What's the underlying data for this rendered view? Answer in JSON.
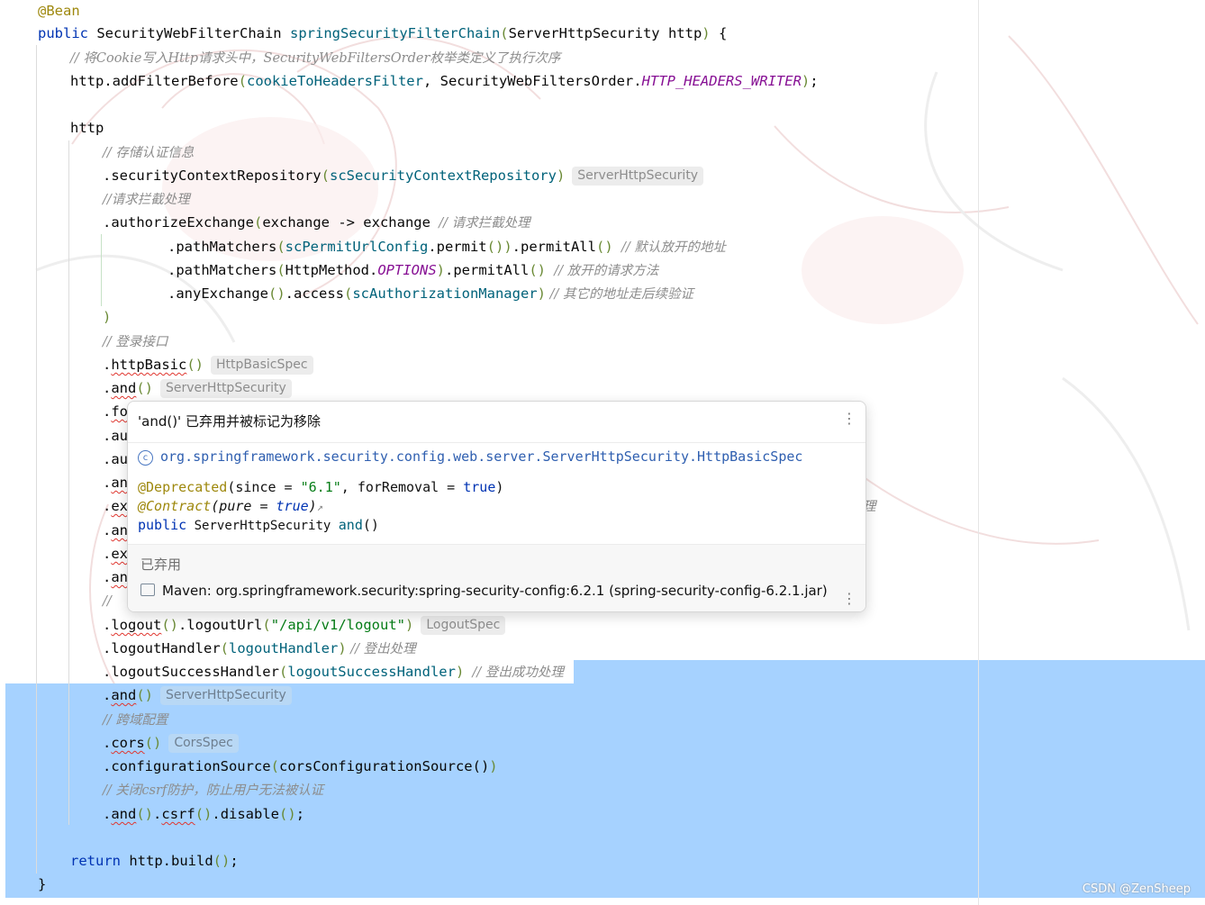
{
  "editor": {
    "lines": {
      "l1": {
        "ann": "@Bean"
      },
      "l2": {
        "kw": "public",
        "type": "SecurityWebFilterChain",
        "method": "springSecurityFilterChain",
        "open": "(",
        "param": "ServerHttpSecurity http",
        "close": ")",
        "brace": " {"
      },
      "l3": {
        "comment": "// 将Cookie写入Http请求头中，SecurityWebFiltersOrder枚举类定义了执行次序"
      },
      "l4": {
        "pre": "http.addFilterBefore",
        "open": "(",
        "arg1": "cookieToHeadersFilter",
        "mid": ", SecurityWebFiltersOrder.",
        "const": "HTTP_HEADERS_WRITER",
        "close": ")",
        "end": ";"
      },
      "l5": {
        "text": "http"
      },
      "l6": {
        "comment": "// 存储认证信息"
      },
      "l7": {
        "pre": ".securityContextRepository",
        "open": "(",
        "arg": "scSecurityContextRepository",
        "close": ")",
        "hint": "ServerHttpSecurity"
      },
      "l8": {
        "comment": "//请求拦截处理"
      },
      "l9": {
        "pre": ".authorizeExchange",
        "open": "(",
        "body": "exchange -> exchange ",
        "comment": "// 请求拦截处理"
      },
      "l10": {
        "pre": ".pathMatchers",
        "open": "(",
        "field": "scPermitUrlConfig",
        "mid": ".permit",
        "paren": "()",
        "close": ")",
        "tail": ".permitAll",
        "paren2": "() ",
        "comment": "// 默认放开的地址"
      },
      "l11": {
        "pre": ".pathMatchers",
        "open": "(",
        "mid": "HttpMethod.",
        "const": "OPTIONS",
        "close": ")",
        "tail": ".permitAll",
        "paren": "() ",
        "comment": "// 放开的请求方法"
      },
      "l12": {
        "pre": ".anyExchange",
        "paren": "()",
        "mid": ".access",
        "open": "(",
        "arg": "scAuthorizationManager",
        "close": ")",
        "comment": " // 其它的地址走后续验证"
      },
      "l13": {
        "text": ")"
      },
      "l14": {
        "comment": "// 登录接口"
      },
      "l15": {
        "dot": ".",
        "method": "httpBasic",
        "paren": "()",
        "hint": "HttpBasicSpec"
      },
      "l16": {
        "dot": ".",
        "method": "and",
        "paren": "()",
        "hint": "ServerHttpSecurity"
      },
      "l17": {
        "dot": ".",
        "method": "fo"
      },
      "l18": {
        "text": ".au"
      },
      "l19": {
        "text": ".au"
      },
      "l20": {
        "dot": ".",
        "method": "an"
      },
      "l21": {
        "dot": ".",
        "method": "ex",
        "peek": "理"
      },
      "l22": {
        "dot": ".",
        "method": "an"
      },
      "l23": {
        "dot": ".",
        "method": "ex"
      },
      "l24": {
        "dot": ".",
        "method": "an"
      },
      "l25": {
        "comment": "//"
      },
      "l26": {
        "dot": ".",
        "method": "logout",
        "paren": "()",
        "mid": ".logoutUrl",
        "open": "(",
        "str": "\"/api/v1/logout\"",
        "close": ")",
        "hint": "LogoutSpec"
      },
      "l27": {
        "pre": ".logoutHandler",
        "open": "(",
        "arg": "logoutHandler",
        "close": ")",
        "comment": " // 登出处理"
      },
      "l28": {
        "pre": ".logoutSuccessHandler",
        "open": "(",
        "arg": "logoutSuccessHandler",
        "close": ")",
        "comment": "  // 登出成功处理"
      },
      "l29": {
        "dot": ".",
        "method": "and",
        "paren": "()",
        "hint": "ServerHttpSecurity"
      },
      "l30": {
        "comment": "// 跨域配置"
      },
      "l31": {
        "dot": ".",
        "method": "cors",
        "paren": "()",
        "hint": "CorsSpec"
      },
      "l32": {
        "pre": ".configurationSource",
        "open": "(",
        "body": "corsConfigurationSource()",
        "close": ")"
      },
      "l33": {
        "comment": "// 关闭csrf防护，防止用户无法被认证"
      },
      "l34": {
        "dot": ".",
        "m1": "and",
        "p1": "()",
        "dot2": ".",
        "m2": "csrf",
        "p2": "()",
        "tail": ".disable",
        "p3": "()",
        "end": ";"
      },
      "l35": {
        "kw": "return",
        "body": " http.build",
        "paren": "()",
        "end": ";"
      },
      "l36": {
        "text": "}"
      }
    }
  },
  "popup": {
    "title": "'and()' 已弃用并被标记为移除",
    "class_icon": "c",
    "class_ref": "org.springframework.security.config.web.server.ServerHttpSecurity.HttpBasicSpec",
    "sig1": {
      "ann": "@Deprecated",
      "open": "(since = ",
      "str": "\"6.1\"",
      "mid": ", forRemoval = ",
      "kw": "true",
      "close": ")"
    },
    "sig2": {
      "ann": "@Contract",
      "body": "(pure = ",
      "kw": "true",
      "close": ")",
      "arrow": "↗"
    },
    "sig3": {
      "kw": "public",
      "type": " ServerHttpSecurity ",
      "method": "and",
      "close": "()"
    },
    "deprecated_label": "已弃用",
    "maven": "Maven: org.springframework.security:spring-security-config:6.2.1 (spring-security-config-6.2.1.jar)",
    "more_icon": "⋮"
  },
  "watermark": "CSDN @ZenSheep"
}
